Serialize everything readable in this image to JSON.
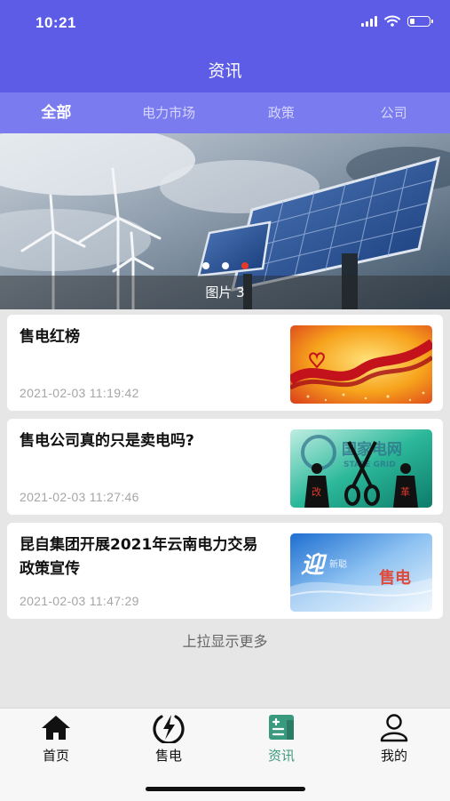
{
  "status_bar": {
    "time": "10:21",
    "battery_level": 0.25
  },
  "nav": {
    "title": "资讯"
  },
  "tabs": [
    {
      "label": "全部",
      "active": true
    },
    {
      "label": "电力市场",
      "active": false
    },
    {
      "label": "政策",
      "active": false
    },
    {
      "label": "公司",
      "active": false
    }
  ],
  "banner": {
    "caption": "图片 3",
    "slide_count": 3,
    "active_slide": 3
  },
  "news": [
    {
      "title": "售电红榜",
      "date": "2021-02-03 11:19:42",
      "thumb": "red-ribbon-heart-image"
    },
    {
      "title": "售电公司真的只是卖电吗?",
      "date": "2021-02-03 11:27:46",
      "thumb": "state-grid-reform-scissors-image",
      "thumb_text": [
        "国家电网",
        "STATE GRID",
        "改",
        "革"
      ]
    },
    {
      "title": "昆自集团开展2021年云南电力交易政策宣传",
      "date": "2021-02-03 11:47:29",
      "thumb": "blue-welcome-banner-image",
      "thumb_text": [
        "迎",
        "新聪",
        "售电"
      ]
    }
  ],
  "load_more": "上拉显示更多",
  "bottom_tabs": [
    {
      "label": "首页",
      "icon": "home-icon",
      "active": false
    },
    {
      "label": "售电",
      "icon": "lightning-icon",
      "active": false
    },
    {
      "label": "资讯",
      "icon": "news-icon",
      "active": true
    },
    {
      "label": "我的",
      "icon": "user-icon",
      "active": false
    }
  ],
  "colors": {
    "primary": "#5c5ce6",
    "tab_bar": "#7b7bf0",
    "active_tab": "#3a9a7d",
    "indicator_active": "#e53a2a"
  }
}
